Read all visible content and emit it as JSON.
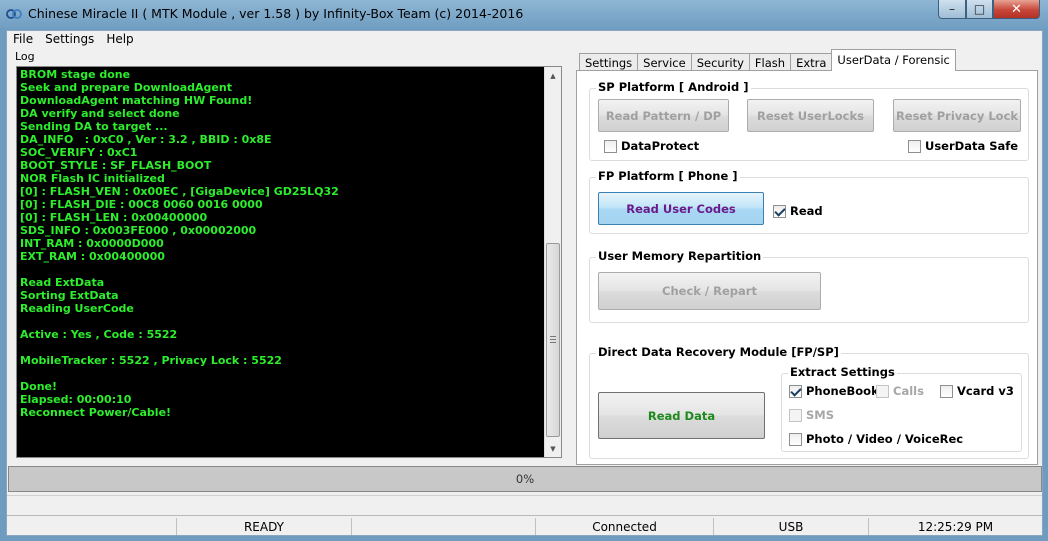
{
  "window": {
    "title": "Chinese Miracle II ( MTK Module , ver 1.58 ) by Infinity-Box Team (c) 2014-2016",
    "minimize": "–",
    "maximize": "□",
    "close": "✕"
  },
  "menu": [
    "File",
    "Settings",
    "Help"
  ],
  "log": {
    "label": "Log",
    "lines": [
      "BROM stage done",
      "Seek and prepare DownloadAgent",
      "DownloadAgent matching HW Found!",
      "DA verify and select done",
      "Sending DA to target ...",
      "DA_INFO   : 0xC0 , Ver : 3.2 , BBID : 0x8E",
      "SOC_VERIFY : 0xC1",
      "BOOT_STYLE : SF_FLASH_BOOT",
      "NOR Flash IC initialized",
      "[0] : FLASH_VEN : 0x00EC , [GigaDevice] GD25LQ32",
      "[0] : FLASH_DIE : 00C8 0060 0016 0000",
      "[0] : FLASH_LEN : 0x00400000",
      "SDS_INFO : 0x003FE000 , 0x00002000",
      "INT_RAM : 0x0000D000",
      "EXT_RAM : 0x00400000",
      "",
      "Read ExtData",
      "Sorting ExtData",
      "Reading UserCode",
      "",
      "Active : Yes , Code : 5522",
      "",
      "MobileTracker : 5522 , Privacy Lock : 5522",
      "",
      "Done!",
      "Elapsed: 00:00:10",
      "Reconnect Power/Cable!"
    ]
  },
  "tabs": [
    "Settings",
    "Service",
    "Security",
    "Flash",
    "Extra",
    "UserData / Forensic"
  ],
  "active_tab": "UserData / Forensic",
  "sp_platform": {
    "title": "SP Platform [ Android ]",
    "read_pattern": "Read Pattern / DP",
    "reset_userlocks": "Reset UserLocks",
    "reset_privacy": "Reset Privacy Lock",
    "dataprotect": {
      "label": "DataProtect",
      "checked": false
    },
    "userdata_safe": {
      "label": "UserData Safe",
      "checked": false
    }
  },
  "fp_platform": {
    "title": "FP Platform [ Phone ]",
    "read_user_codes": "Read User Codes",
    "read": {
      "label": "Read",
      "checked": true
    }
  },
  "user_memory": {
    "title": "User Memory Repartition",
    "check_repart": "Check / Repart"
  },
  "direct_recovery": {
    "title": "Direct Data Recovery Module  [FP/SP]",
    "read_data": "Read Data",
    "extract_title": "Extract Settings",
    "phonebook": {
      "label": "PhoneBook",
      "checked": true
    },
    "calls": {
      "label": "Calls",
      "checked": false,
      "disabled": true
    },
    "vcard": {
      "label": "Vcard v3",
      "checked": false
    },
    "sms": {
      "label": "SMS",
      "checked": false,
      "disabled": true
    },
    "photo": {
      "label": "Photo / Video / VoiceRec",
      "checked": false
    }
  },
  "progress": {
    "text": "0%",
    "value": 0
  },
  "statusbar": {
    "state": "READY",
    "connection": "Connected",
    "port": "USB",
    "time": "12:25:29 PM"
  },
  "colors": {
    "log_bg": "#000000",
    "log_text": "#2ded2d",
    "accent_button": "#a8d8f4",
    "close_button": "#c8473a"
  }
}
